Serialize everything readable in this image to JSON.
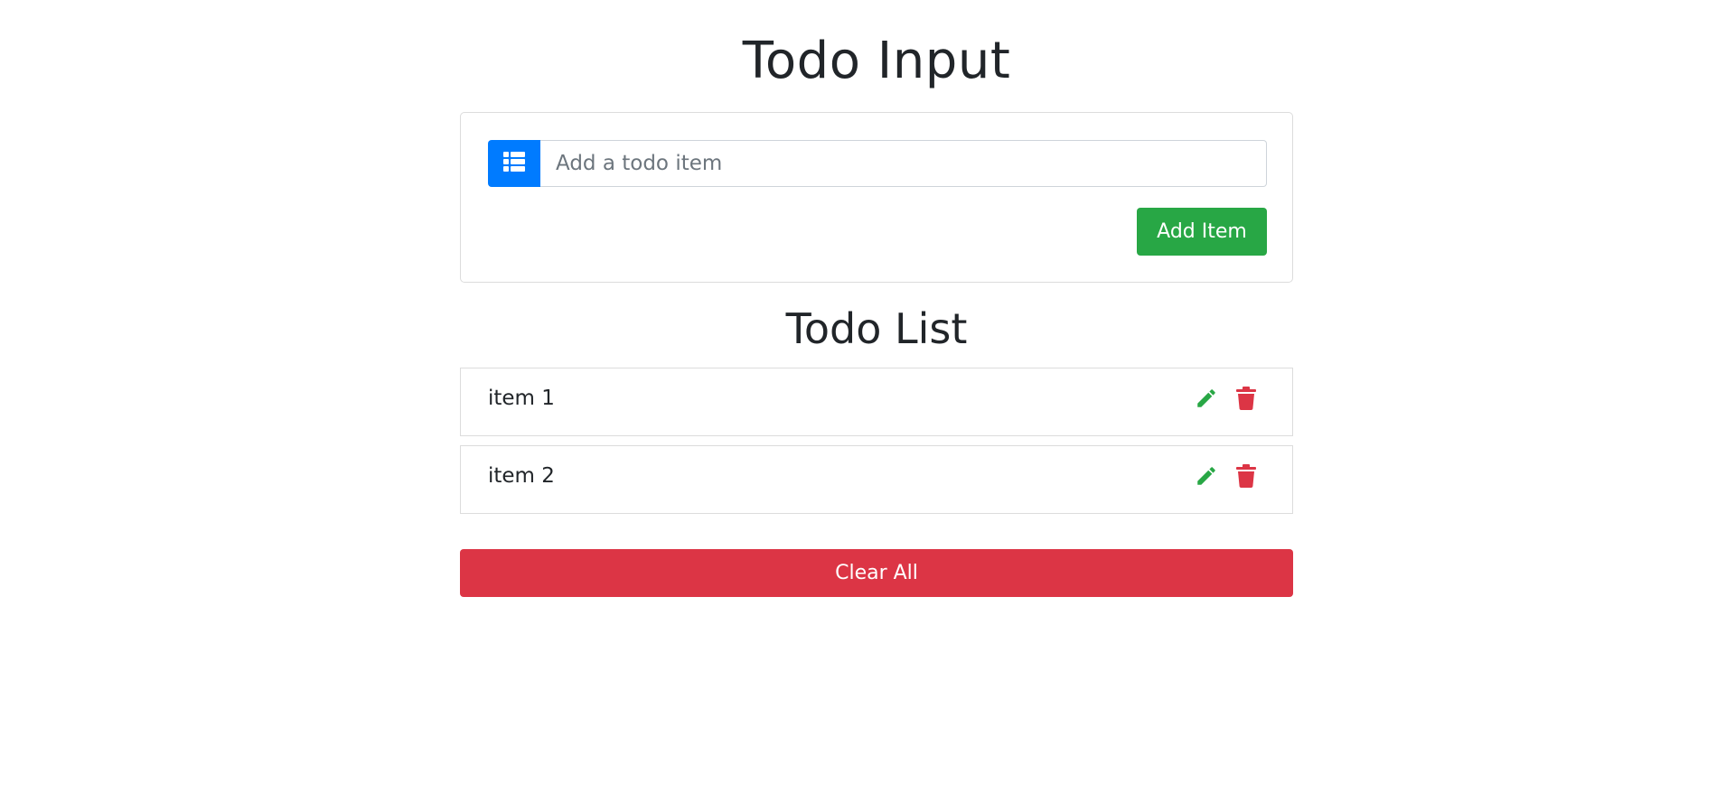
{
  "header": {
    "title": "Todo Input"
  },
  "input": {
    "placeholder": "Add a todo item",
    "value": "",
    "prepend_icon": "list-icon",
    "add_label": "Add Item"
  },
  "list": {
    "title": "Todo List",
    "items": [
      {
        "label": "item 1",
        "edit_icon": "pencil-icon",
        "delete_icon": "trash-icon"
      },
      {
        "label": "item 2",
        "edit_icon": "pencil-icon",
        "delete_icon": "trash-icon"
      }
    ],
    "clear_label": "Clear All"
  },
  "colors": {
    "primary": "#007bff",
    "success": "#28a745",
    "danger": "#dc3545",
    "text": "#212529",
    "border": "#dcdcdc"
  }
}
